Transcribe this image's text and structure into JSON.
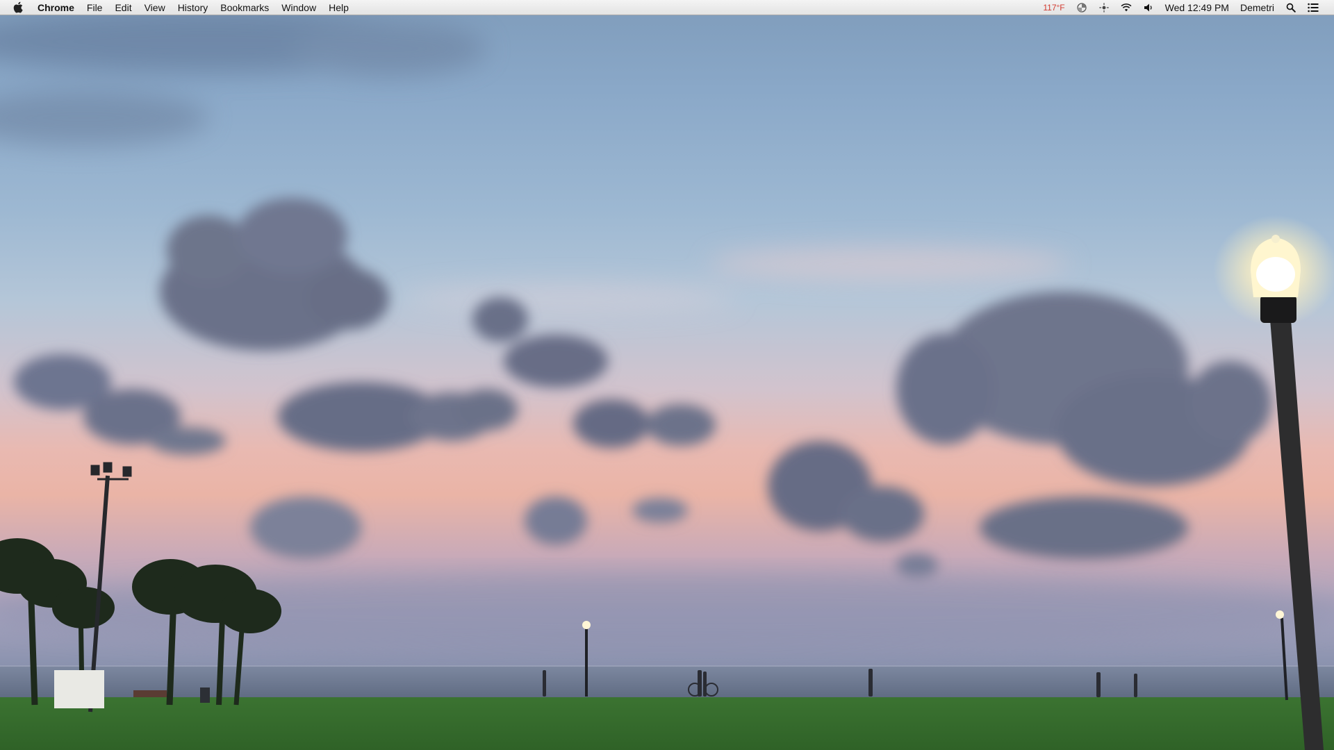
{
  "menubar": {
    "apple_icon": "apple-logo-icon",
    "app_name": "Chrome",
    "menus": [
      "File",
      "Edit",
      "View",
      "History",
      "Bookmarks",
      "Window",
      "Help"
    ],
    "status": {
      "temperature": "117°F",
      "datetime": "Wed 12:49 PM",
      "user": "Demetri",
      "icons": [
        "disk-activity-icon",
        "brightness-icon",
        "wifi-icon",
        "volume-icon",
        "spotlight-search-icon",
        "notification-center-icon"
      ]
    }
  },
  "desktop": {
    "wallpaper": "sunset-waterfront-park",
    "colors": {
      "sky_top": "#7f9cbb",
      "sky_pink": "#eab4a6",
      "water": "#6f7d95",
      "grass": "#3f7a33",
      "accent_temp": "#d23a2f"
    }
  }
}
